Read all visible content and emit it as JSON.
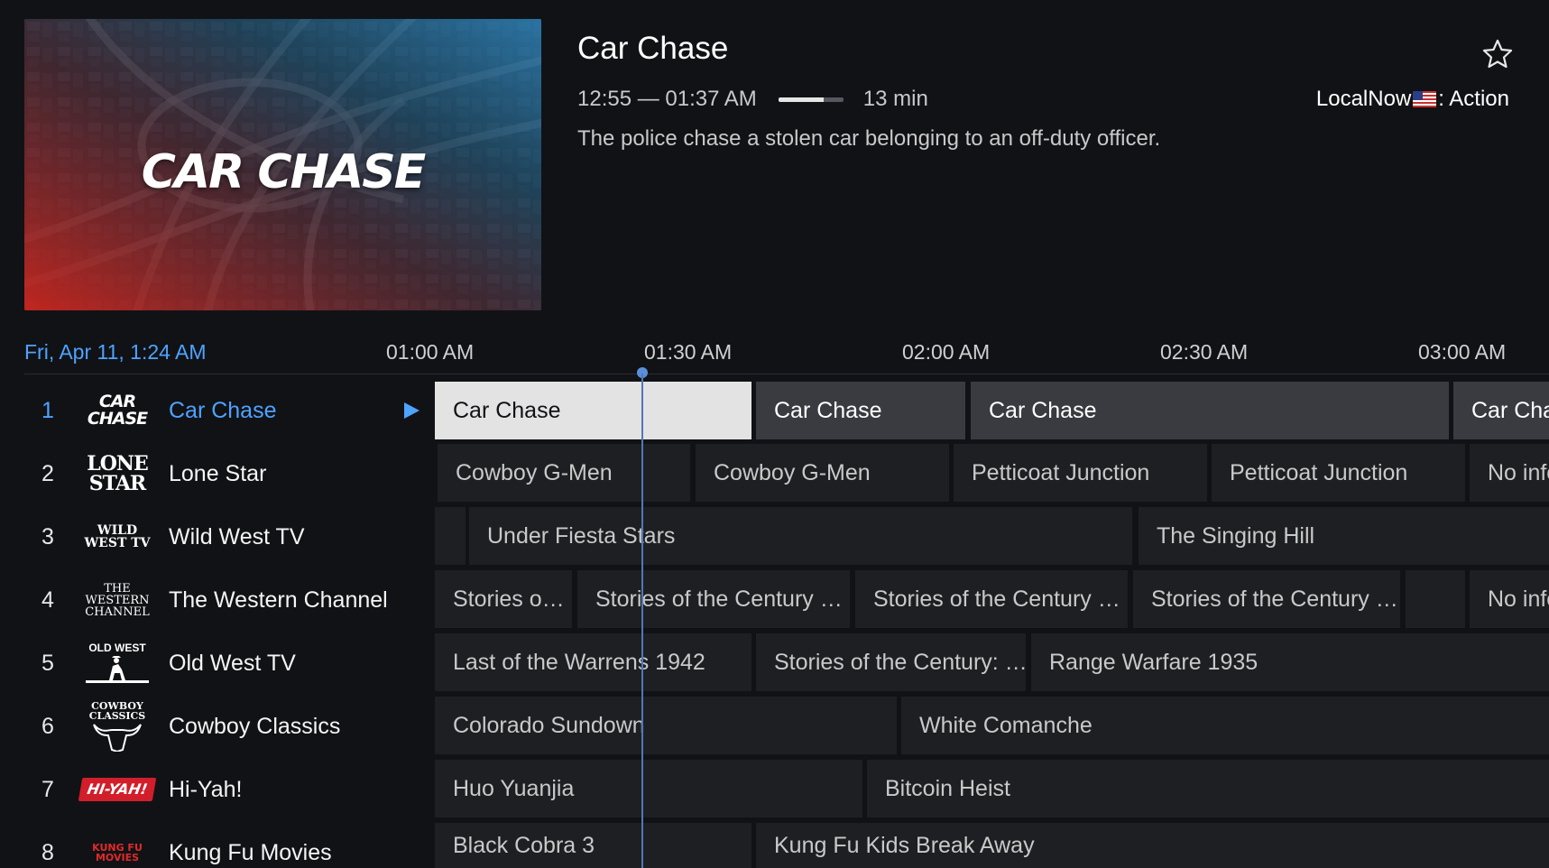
{
  "preview": {
    "title_art": "CAR CHASE"
  },
  "program_info": {
    "title": "Car Chase",
    "time_range": "12:55 — 01:37 AM",
    "progress": 0.7,
    "remaining": "13 min",
    "channel_prefix": "LocalNow",
    "channel_suffix": ": Action",
    "description": "The police chase a stolen car belonging to an off-duty officer."
  },
  "timeline": {
    "current_datetime": "Fri, Apr 11, 1:24 AM",
    "slots": [
      "01:00 AM",
      "01:30 AM",
      "02:00 AM",
      "02:30 AM",
      "03:00 AM"
    ]
  },
  "channels": [
    {
      "number": "1",
      "name": "Car Chase",
      "logo": "CAR CHASE",
      "active": true,
      "programs": [
        {
          "title": "Car Chase",
          "start": 0,
          "end": 1,
          "state": "selected"
        },
        {
          "title": "Car Chase",
          "start": 1,
          "end": 2,
          "state": "live"
        },
        {
          "title": "Car Chase",
          "start": 2,
          "end": 3,
          "state": "live"
        },
        {
          "title": "Car Chase",
          "start": 3,
          "end": 4,
          "state": "live"
        }
      ]
    },
    {
      "number": "2",
      "name": "Lone Star",
      "logo": "LONE STAR",
      "programs": [
        {
          "title": "Cowboy G-Men"
        },
        {
          "title": "Cowboy G-Men"
        },
        {
          "title": "Petticoat Junction"
        },
        {
          "title": "Petticoat Junction"
        },
        {
          "title": "No info"
        }
      ]
    },
    {
      "number": "3",
      "name": "Wild West TV",
      "logo": "WILD WEST TV",
      "programs": [
        {
          "title": ""
        },
        {
          "title": "Under Fiesta Stars"
        },
        {
          "title": "The Singing Hill"
        }
      ]
    },
    {
      "number": "4",
      "name": "The Western Channel",
      "logo": "THE WESTERN CHANNEL",
      "programs": [
        {
          "title": "Stories o…"
        },
        {
          "title": "Stories of the Century …"
        },
        {
          "title": "Stories of the Century …"
        },
        {
          "title": "Stories of the Century …"
        },
        {
          "title": ""
        },
        {
          "title": "No info"
        }
      ]
    },
    {
      "number": "5",
      "name": "Old West TV",
      "logo": "OLD WEST",
      "programs": [
        {
          "title": "Last of the Warrens 1942"
        },
        {
          "title": "Stories of the Century: …"
        },
        {
          "title": "Range Warfare 1935"
        }
      ]
    },
    {
      "number": "6",
      "name": "Cowboy Classics",
      "logo": "COWBOY CLASSICS",
      "programs": [
        {
          "title": "Colorado Sundown"
        },
        {
          "title": "White Comanche"
        }
      ]
    },
    {
      "number": "7",
      "name": "Hi-Yah!",
      "logo": "HI-YAH!",
      "programs": [
        {
          "title": "Huo Yuanjia"
        },
        {
          "title": "Bitcoin Heist"
        }
      ]
    },
    {
      "number": "8",
      "name": "Kung Fu Movies",
      "logo": "KUNG FU MOVIES",
      "programs": [
        {
          "title": "Black Cobra 3"
        },
        {
          "title": "Kung Fu Kids Break Away"
        }
      ]
    }
  ]
}
